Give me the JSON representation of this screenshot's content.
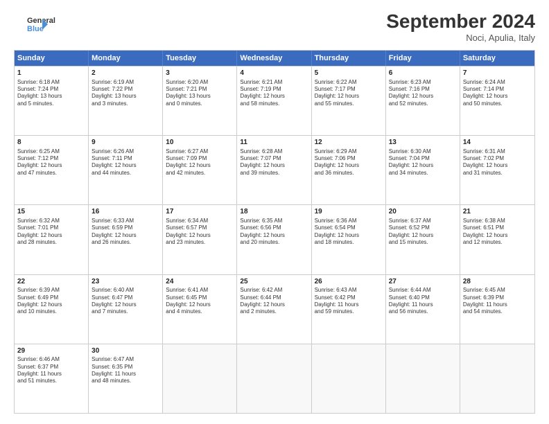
{
  "header": {
    "logo_line1": "General",
    "logo_line2": "Blue",
    "month_title": "September 2024",
    "location": "Noci, Apulia, Italy"
  },
  "days_of_week": [
    "Sunday",
    "Monday",
    "Tuesday",
    "Wednesday",
    "Thursday",
    "Friday",
    "Saturday"
  ],
  "weeks": [
    [
      {
        "day": "1",
        "lines": [
          "Sunrise: 6:18 AM",
          "Sunset: 7:24 PM",
          "Daylight: 13 hours",
          "and 5 minutes."
        ]
      },
      {
        "day": "2",
        "lines": [
          "Sunrise: 6:19 AM",
          "Sunset: 7:22 PM",
          "Daylight: 13 hours",
          "and 3 minutes."
        ]
      },
      {
        "day": "3",
        "lines": [
          "Sunrise: 6:20 AM",
          "Sunset: 7:21 PM",
          "Daylight: 13 hours",
          "and 0 minutes."
        ]
      },
      {
        "day": "4",
        "lines": [
          "Sunrise: 6:21 AM",
          "Sunset: 7:19 PM",
          "Daylight: 12 hours",
          "and 58 minutes."
        ]
      },
      {
        "day": "5",
        "lines": [
          "Sunrise: 6:22 AM",
          "Sunset: 7:17 PM",
          "Daylight: 12 hours",
          "and 55 minutes."
        ]
      },
      {
        "day": "6",
        "lines": [
          "Sunrise: 6:23 AM",
          "Sunset: 7:16 PM",
          "Daylight: 12 hours",
          "and 52 minutes."
        ]
      },
      {
        "day": "7",
        "lines": [
          "Sunrise: 6:24 AM",
          "Sunset: 7:14 PM",
          "Daylight: 12 hours",
          "and 50 minutes."
        ]
      }
    ],
    [
      {
        "day": "8",
        "lines": [
          "Sunrise: 6:25 AM",
          "Sunset: 7:12 PM",
          "Daylight: 12 hours",
          "and 47 minutes."
        ]
      },
      {
        "day": "9",
        "lines": [
          "Sunrise: 6:26 AM",
          "Sunset: 7:11 PM",
          "Daylight: 12 hours",
          "and 44 minutes."
        ]
      },
      {
        "day": "10",
        "lines": [
          "Sunrise: 6:27 AM",
          "Sunset: 7:09 PM",
          "Daylight: 12 hours",
          "and 42 minutes."
        ]
      },
      {
        "day": "11",
        "lines": [
          "Sunrise: 6:28 AM",
          "Sunset: 7:07 PM",
          "Daylight: 12 hours",
          "and 39 minutes."
        ]
      },
      {
        "day": "12",
        "lines": [
          "Sunrise: 6:29 AM",
          "Sunset: 7:06 PM",
          "Daylight: 12 hours",
          "and 36 minutes."
        ]
      },
      {
        "day": "13",
        "lines": [
          "Sunrise: 6:30 AM",
          "Sunset: 7:04 PM",
          "Daylight: 12 hours",
          "and 34 minutes."
        ]
      },
      {
        "day": "14",
        "lines": [
          "Sunrise: 6:31 AM",
          "Sunset: 7:02 PM",
          "Daylight: 12 hours",
          "and 31 minutes."
        ]
      }
    ],
    [
      {
        "day": "15",
        "lines": [
          "Sunrise: 6:32 AM",
          "Sunset: 7:01 PM",
          "Daylight: 12 hours",
          "and 28 minutes."
        ]
      },
      {
        "day": "16",
        "lines": [
          "Sunrise: 6:33 AM",
          "Sunset: 6:59 PM",
          "Daylight: 12 hours",
          "and 26 minutes."
        ]
      },
      {
        "day": "17",
        "lines": [
          "Sunrise: 6:34 AM",
          "Sunset: 6:57 PM",
          "Daylight: 12 hours",
          "and 23 minutes."
        ]
      },
      {
        "day": "18",
        "lines": [
          "Sunrise: 6:35 AM",
          "Sunset: 6:56 PM",
          "Daylight: 12 hours",
          "and 20 minutes."
        ]
      },
      {
        "day": "19",
        "lines": [
          "Sunrise: 6:36 AM",
          "Sunset: 6:54 PM",
          "Daylight: 12 hours",
          "and 18 minutes."
        ]
      },
      {
        "day": "20",
        "lines": [
          "Sunrise: 6:37 AM",
          "Sunset: 6:52 PM",
          "Daylight: 12 hours",
          "and 15 minutes."
        ]
      },
      {
        "day": "21",
        "lines": [
          "Sunrise: 6:38 AM",
          "Sunset: 6:51 PM",
          "Daylight: 12 hours",
          "and 12 minutes."
        ]
      }
    ],
    [
      {
        "day": "22",
        "lines": [
          "Sunrise: 6:39 AM",
          "Sunset: 6:49 PM",
          "Daylight: 12 hours",
          "and 10 minutes."
        ]
      },
      {
        "day": "23",
        "lines": [
          "Sunrise: 6:40 AM",
          "Sunset: 6:47 PM",
          "Daylight: 12 hours",
          "and 7 minutes."
        ]
      },
      {
        "day": "24",
        "lines": [
          "Sunrise: 6:41 AM",
          "Sunset: 6:45 PM",
          "Daylight: 12 hours",
          "and 4 minutes."
        ]
      },
      {
        "day": "25",
        "lines": [
          "Sunrise: 6:42 AM",
          "Sunset: 6:44 PM",
          "Daylight: 12 hours",
          "and 2 minutes."
        ]
      },
      {
        "day": "26",
        "lines": [
          "Sunrise: 6:43 AM",
          "Sunset: 6:42 PM",
          "Daylight: 11 hours",
          "and 59 minutes."
        ]
      },
      {
        "day": "27",
        "lines": [
          "Sunrise: 6:44 AM",
          "Sunset: 6:40 PM",
          "Daylight: 11 hours",
          "and 56 minutes."
        ]
      },
      {
        "day": "28",
        "lines": [
          "Sunrise: 6:45 AM",
          "Sunset: 6:39 PM",
          "Daylight: 11 hours",
          "and 54 minutes."
        ]
      }
    ],
    [
      {
        "day": "29",
        "lines": [
          "Sunrise: 6:46 AM",
          "Sunset: 6:37 PM",
          "Daylight: 11 hours",
          "and 51 minutes."
        ]
      },
      {
        "day": "30",
        "lines": [
          "Sunrise: 6:47 AM",
          "Sunset: 6:35 PM",
          "Daylight: 11 hours",
          "and 48 minutes."
        ]
      },
      {
        "day": "",
        "lines": []
      },
      {
        "day": "",
        "lines": []
      },
      {
        "day": "",
        "lines": []
      },
      {
        "day": "",
        "lines": []
      },
      {
        "day": "",
        "lines": []
      }
    ]
  ]
}
